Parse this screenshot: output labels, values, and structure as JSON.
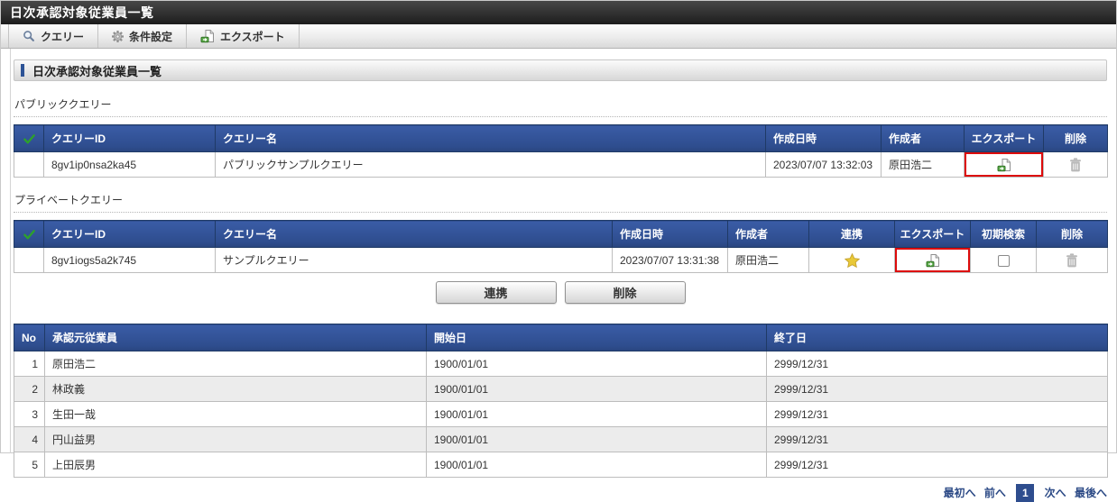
{
  "page": {
    "title": "日次承認対象従業員一覧"
  },
  "toolbar": {
    "query_label": "クエリー",
    "condition_label": "条件設定",
    "export_label": "エクスポート"
  },
  "section": {
    "title": "日次承認対象従業員一覧"
  },
  "public_query": {
    "label": "パブリッククエリー",
    "headers": {
      "id": "クエリーID",
      "name": "クエリー名",
      "created_at": "作成日時",
      "created_by": "作成者",
      "export": "エクスポート",
      "delete": "削除"
    },
    "row": {
      "id": "8gv1ip0nsa2ka45",
      "name": "パブリックサンプルクエリー",
      "created_at": "2023/07/07 13:32:03",
      "created_by": "原田浩二"
    }
  },
  "private_query": {
    "label": "プライベートクエリー",
    "headers": {
      "id": "クエリーID",
      "name": "クエリー名",
      "created_at": "作成日時",
      "created_by": "作成者",
      "link": "連携",
      "export": "エクスポート",
      "initial_search": "初期検索",
      "delete": "削除"
    },
    "row": {
      "id": "8gv1iogs5a2k745",
      "name": "サンプルクエリー",
      "created_at": "2023/07/07 13:31:38",
      "created_by": "原田浩二",
      "link_starred": "true",
      "initial_search_checked": "false"
    }
  },
  "actions": {
    "link_label": "連携",
    "delete_label": "削除"
  },
  "employee_table": {
    "headers": {
      "no": "No",
      "employee": "承認元従業員",
      "start": "開始日",
      "end": "終了日"
    },
    "rows": [
      {
        "no": "1",
        "employee": "原田浩二",
        "start": "1900/01/01",
        "end": "2999/12/31"
      },
      {
        "no": "2",
        "employee": "林政義",
        "start": "1900/01/01",
        "end": "2999/12/31"
      },
      {
        "no": "3",
        "employee": "生田一哉",
        "start": "1900/01/01",
        "end": "2999/12/31"
      },
      {
        "no": "4",
        "employee": "円山益男",
        "start": "1900/01/01",
        "end": "2999/12/31"
      },
      {
        "no": "5",
        "employee": "上田辰男",
        "start": "1900/01/01",
        "end": "2999/12/31"
      }
    ]
  },
  "pagination": {
    "first": "最初へ",
    "prev": "前へ",
    "current": "1",
    "next": "次へ",
    "last": "最後へ"
  },
  "colors": {
    "header_blue": "#2e4d8e",
    "accent_blue": "#2d5396",
    "highlight_red": "#dd0b0b",
    "star_gold": "#e9c938"
  }
}
